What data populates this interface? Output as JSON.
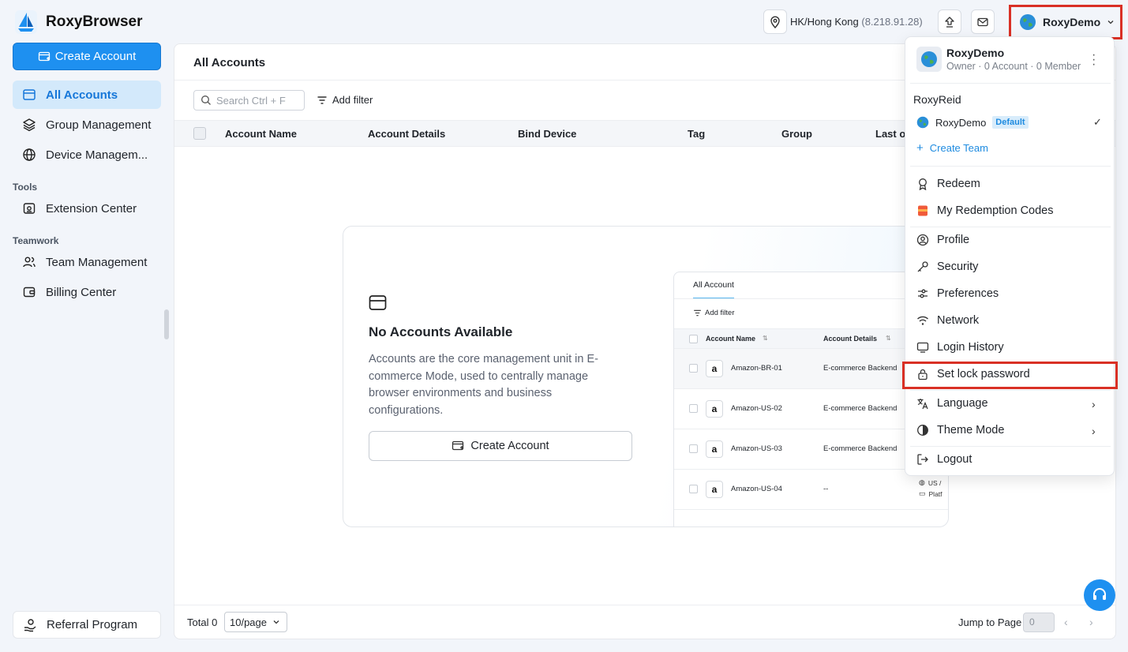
{
  "app": {
    "title": "RoxyBrowser"
  },
  "topbar": {
    "location": "HK/Hong Kong",
    "ip": "(8.218.91.28)",
    "user": "RoxyDemo"
  },
  "sidebar": {
    "create_label": "Create Account",
    "items": [
      {
        "label": "All Accounts",
        "icon": "card-icon",
        "active": true
      },
      {
        "label": "Group Management",
        "icon": "layers-icon"
      },
      {
        "label": "Device Managem...",
        "icon": "globe-icon"
      }
    ],
    "tools_label": "Tools",
    "tools": [
      {
        "label": "Extension Center",
        "icon": "puzzle-icon"
      }
    ],
    "teamwork_label": "Teamwork",
    "teamwork": [
      {
        "label": "Team Management",
        "icon": "users-icon"
      },
      {
        "label": "Billing Center",
        "icon": "wallet-icon"
      }
    ],
    "referral": "Referral Program"
  },
  "main": {
    "title": "All Accounts",
    "search_placeholder": "Search Ctrl + F",
    "add_filter": "Add filter",
    "columns": [
      "Account Name",
      "Account Details",
      "Bind Device",
      "Tag",
      "Group",
      "Last o"
    ],
    "empty": {
      "title": "No Accounts Available",
      "description": "Accounts are the core management unit in E-commerce Mode, used to centrally manage browser environments and business configurations.",
      "button": "Create Account"
    },
    "preview": {
      "tab": "All Account",
      "add_filter": "Add filter",
      "columns": [
        "Account Name",
        "Account Details"
      ],
      "rows": [
        {
          "name": "Amazon-BR-01",
          "details": "E-commerce Backend"
        },
        {
          "name": "Amazon-US-02",
          "details": "E-commerce Backend"
        },
        {
          "name": "Amazon-US-03",
          "details": "E-commerce Backend"
        },
        {
          "name": "Amazon-US-04",
          "details": "--"
        }
      ],
      "extra_1": "US /",
      "extra_2": "Platf"
    },
    "footer": {
      "total": "Total 0",
      "page_size": "10/page",
      "jump_label": "Jump to Page",
      "jump_value": "0"
    }
  },
  "dropdown": {
    "name": "RoxyDemo",
    "subtitle": "Owner · 0 Account · 0 Member",
    "team_section": "RoxyReid",
    "team_name": "RoxyDemo",
    "team_badge": "Default",
    "create_team": "Create Team",
    "items": {
      "redeem": "Redeem",
      "codes": "My Redemption Codes",
      "profile": "Profile",
      "security": "Security",
      "preferences": "Preferences",
      "network": "Network",
      "login_history": "Login History",
      "lock": "Set lock password",
      "language": "Language",
      "theme": "Theme Mode",
      "logout": "Logout"
    }
  }
}
